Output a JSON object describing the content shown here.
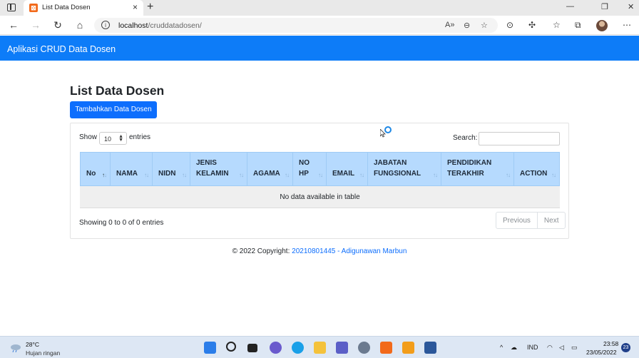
{
  "browser": {
    "tab_title": "List Data Dosen",
    "tab_favicon": "xampp-icon",
    "new_tab_symbol": "+",
    "url_host": "localhost",
    "url_path": "/cruddatadosen/"
  },
  "navbar": {
    "brand": "Aplikasi CRUD Data Dosen"
  },
  "page": {
    "title": "List Data Dosen",
    "add_button": "Tambahkan Data Dosen"
  },
  "table_controls": {
    "show_label": "Show",
    "length_value": "10",
    "entries_label": "entries",
    "search_label": "Search:"
  },
  "table": {
    "columns": [
      {
        "line1": "No",
        "line2": ""
      },
      {
        "line1": "NAMA",
        "line2": ""
      },
      {
        "line1": "NIDN",
        "line2": ""
      },
      {
        "line1": "JENIS",
        "line2": "KELAMIN"
      },
      {
        "line1": "AGAMA",
        "line2": ""
      },
      {
        "line1": "NO",
        "line2": "HP"
      },
      {
        "line1": "EMAIL",
        "line2": ""
      },
      {
        "line1": "JABATAN",
        "line2": "FUNGSIONAL"
      },
      {
        "line1": "PENDIDIKAN",
        "line2": "TERAKHIR"
      },
      {
        "line1": "ACTION",
        "line2": ""
      }
    ],
    "empty_message": "No data available in table",
    "info": "Showing 0 to 0 of 0 entries",
    "pager_prev": "Previous",
    "pager_next": "Next"
  },
  "footer": {
    "prefix": "© 2022 Copyright: ",
    "link": "20210801445 - Adigunawan Marbun"
  },
  "taskbar": {
    "temperature": "28°C",
    "weather": "Hujan ringan",
    "language": "IND",
    "time": "23:58",
    "date": "23/05/2022",
    "notification_count": "23"
  },
  "colors": {
    "navbar": "#0d7cf8",
    "primary_button": "#0d6efd",
    "table_header": "#b6dafe",
    "footer_link": "#0d6efd"
  }
}
